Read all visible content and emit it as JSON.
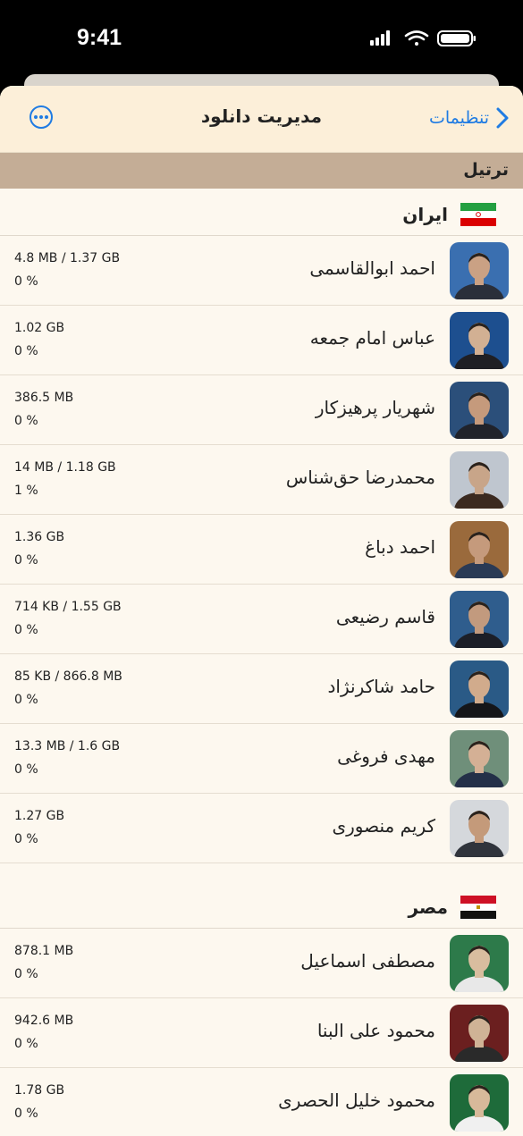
{
  "status_bar": {
    "time": "9:41"
  },
  "nav": {
    "title": "مدیریت دانلود",
    "back_label": "تنظیمات"
  },
  "section": {
    "title": "ترتیل"
  },
  "countries": [
    {
      "name": "ایران",
      "flag": "iran-flag-icon",
      "reciters": [
        {
          "name": "احمد ابوالقاسمی",
          "size": "4.8 MB / 1.37 GB",
          "percent": "0 %",
          "avatar_bg": "#3a6fb0",
          "skin": "#caa184",
          "shirt": "#2a2f3a"
        },
        {
          "name": "عباس امام جمعه",
          "size": "1.02 GB",
          "percent": "0 %",
          "avatar_bg": "#1d4f8f",
          "skin": "#d2b093",
          "shirt": "#1f1f24"
        },
        {
          "name": "شهریار پرهیزکار",
          "size": "386.5 MB",
          "percent": "0 %",
          "avatar_bg": "#2b4f7a",
          "skin": "#c59a7c",
          "shirt": "#20232b"
        },
        {
          "name": "محمدرضا حق‌شناس",
          "size": "14 MB / 1.18 GB",
          "percent": "1 %",
          "avatar_bg": "#bfc6cf",
          "skin": "#c8a589",
          "shirt": "#3b2a20"
        },
        {
          "name": "احمد دباغ",
          "size": "1.36 GB",
          "percent": "0 %",
          "avatar_bg": "#9a6a3c",
          "skin": "#c59a7c",
          "shirt": "#2a3a55"
        },
        {
          "name": "قاسم رضیعی",
          "size": "714 KB / 1.55 GB",
          "percent": "0 %",
          "avatar_bg": "#2f5d8d",
          "skin": "#c29a7e",
          "shirt": "#1c1f28"
        },
        {
          "name": "حامد شاکرنژاد",
          "size": "85 KB / 866.8 MB",
          "percent": "0 %",
          "avatar_bg": "#2a5a86",
          "skin": "#d1ab8c",
          "shirt": "#15161a"
        },
        {
          "name": "مهدی فروغی",
          "size": "13.3 MB / 1.6 GB",
          "percent": "0 %",
          "avatar_bg": "#6f8f7a",
          "skin": "#d4b095",
          "shirt": "#243048"
        },
        {
          "name": "کریم منصوری",
          "size": "1.27 GB",
          "percent": "0 %",
          "avatar_bg": "#d5d8dc",
          "skin": "#c49a7a",
          "shirt": "#30343c"
        }
      ]
    },
    {
      "name": "مصر",
      "flag": "egypt-flag-icon",
      "reciters": [
        {
          "name": "مصطفی اسماعیل",
          "size": "878.1 MB",
          "percent": "0 %",
          "avatar_bg": "#2d7a4a",
          "skin": "#d9bd9f",
          "shirt": "#e8e8e8"
        },
        {
          "name": "محمود علی البنا",
          "size": "942.6 MB",
          "percent": "0 %",
          "avatar_bg": "#6b1f1f",
          "skin": "#cfb396",
          "shirt": "#2a2a2a"
        },
        {
          "name": "محمود خلیل الحصری",
          "size": "1.78 GB",
          "percent": "0 %",
          "avatar_bg": "#1e6b3a",
          "skin": "#d7b99a",
          "shirt": "#f0f0f0"
        }
      ]
    }
  ],
  "colors": {
    "accent": "#1f7be3",
    "sheet_bg": "#fdf8ef",
    "nav_bg": "#fcefd9",
    "section_header_bg": "#c4ad96"
  }
}
